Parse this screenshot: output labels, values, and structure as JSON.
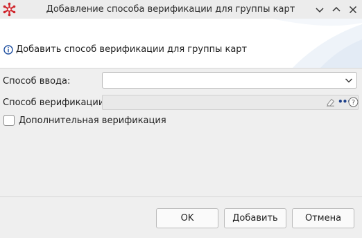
{
  "window": {
    "title": "Добавление способа верификации для группы карт"
  },
  "header": {
    "info_text": "Добавить способ верификации для группы карт"
  },
  "form": {
    "input_method": {
      "label": "Способ ввода:",
      "value": ""
    },
    "verification_method": {
      "label": "Способ верификации:",
      "value": ""
    },
    "additional_verification": {
      "label": "Дополнительная верификация",
      "checked": false
    }
  },
  "buttons": {
    "ok": "OK",
    "add": "Добавить",
    "cancel": "Отмена"
  },
  "colors": {
    "app_icon": "#d0242b",
    "info_icon": "#1e4fa0",
    "header_deco": "#dfe8f3"
  }
}
